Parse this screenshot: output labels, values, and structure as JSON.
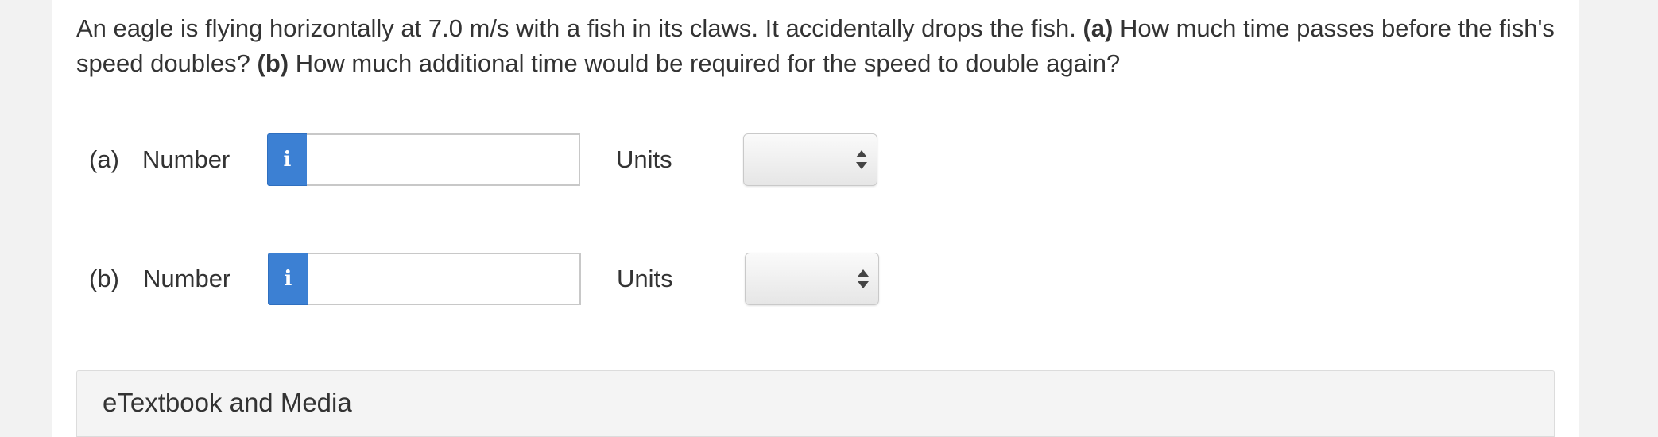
{
  "question": {
    "intro": "An eagle is flying horizontally at 7.0 m/s with a fish in its claws. It accidentally drops the fish.",
    "part_a_tag": "(a)",
    "part_a_text": "How much time passes before the fish's speed doubles?",
    "part_b_tag": "(b)",
    "part_b_text": "How much additional time would be required for the speed to double again?"
  },
  "answers": [
    {
      "part": "(a)",
      "number_label": "Number",
      "info_icon": "i",
      "number_value": "",
      "units_label": "Units",
      "units_selected": ""
    },
    {
      "part": "(b)",
      "number_label": "Number",
      "info_icon": "i",
      "number_value": "",
      "units_label": "Units",
      "units_selected": ""
    }
  ],
  "etextbook": {
    "title": "eTextbook and Media"
  },
  "colors": {
    "info_button": "#3c80d3",
    "text": "#333333",
    "panel": "#f4f4f4"
  }
}
